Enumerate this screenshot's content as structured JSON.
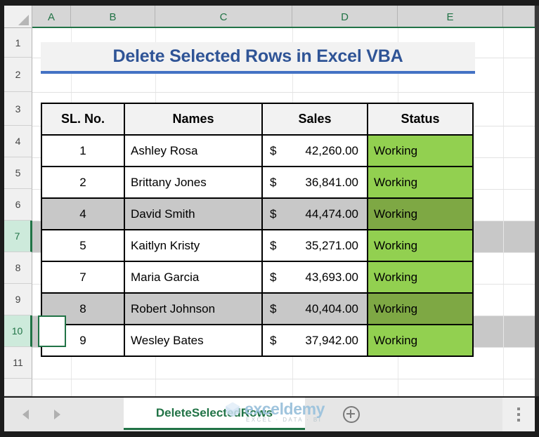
{
  "app": {
    "title": "Delete Selected Rows in Excel VBA"
  },
  "grid": {
    "columns": [
      "A",
      "B",
      "C",
      "D",
      "E"
    ],
    "rows": [
      "1",
      "2",
      "3",
      "4",
      "5",
      "6",
      "7",
      "8",
      "9",
      "10",
      "11"
    ],
    "selected_rows": [
      "7",
      "10"
    ],
    "active_cell": "A10"
  },
  "table": {
    "headers": [
      "SL. No.",
      "Names",
      "Sales",
      "Status"
    ],
    "rows": [
      {
        "sl": "1",
        "name": "Ashley Rosa",
        "currency": "$",
        "amount": "42,260.00",
        "status": "Working",
        "selected": false
      },
      {
        "sl": "2",
        "name": "Brittany Jones",
        "currency": "$",
        "amount": "36,841.00",
        "status": "Working",
        "selected": false
      },
      {
        "sl": "4",
        "name": "David Smith",
        "currency": "$",
        "amount": "44,474.00",
        "status": "Working",
        "selected": true
      },
      {
        "sl": "5",
        "name": "Kaitlyn Kristy",
        "currency": "$",
        "amount": "35,271.00",
        "status": "Working",
        "selected": false
      },
      {
        "sl": "7",
        "name": "Maria Garcia",
        "currency": "$",
        "amount": "43,693.00",
        "status": "Working",
        "selected": false
      },
      {
        "sl": "8",
        "name": "Robert Johnson",
        "currency": "$",
        "amount": "40,404.00",
        "status": "Working",
        "selected": true
      },
      {
        "sl": "9",
        "name": "Wesley Bates",
        "currency": "$",
        "amount": "37,942.00",
        "status": "Working",
        "selected": false
      }
    ]
  },
  "tabbar": {
    "sheet_name": "DeleteSelectedRows",
    "prev_icon": "arrow-left-icon",
    "next_icon": "arrow-right-icon",
    "add_icon": "plus-circle-icon",
    "options_icon": "more-options-icon"
  },
  "watermark": {
    "word": "exceldemy",
    "tagline": "EXCEL · DATA · BI"
  },
  "colors": {
    "accent_green": "#217346",
    "status_green": "#92d050",
    "status_green_selected": "#7ea844",
    "title_blue": "#2f5496",
    "title_rule_blue": "#4472c4",
    "selection_gray": "#c8c8c8"
  }
}
